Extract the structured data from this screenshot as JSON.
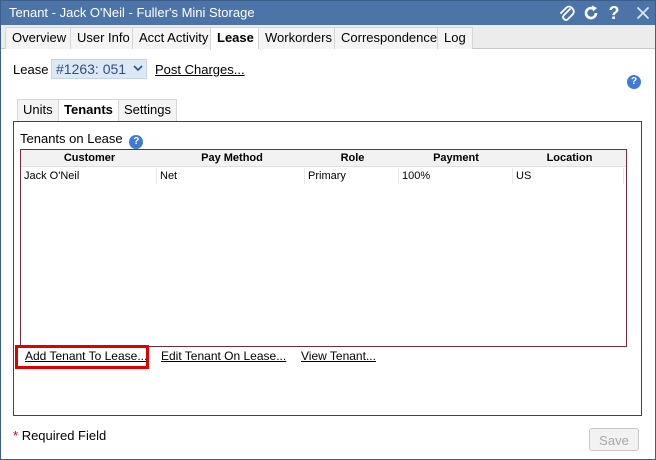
{
  "window": {
    "title": "Tenant - Jack O'Neil - Fuller's Mini Storage"
  },
  "tabs": [
    {
      "label": "Overview",
      "active": false
    },
    {
      "label": "User Info",
      "active": false
    },
    {
      "label": "Acct Activity",
      "active": false
    },
    {
      "label": "Lease",
      "active": true
    },
    {
      "label": "Workorders",
      "active": false
    },
    {
      "label": "Correspondence",
      "active": false
    },
    {
      "label": "Log",
      "active": false
    }
  ],
  "lease": {
    "label": "Lease",
    "selected": "#1263: 051",
    "post_charges": "Post Charges..."
  },
  "subtabs": [
    {
      "label": "Units",
      "active": false
    },
    {
      "label": "Tenants",
      "active": true
    },
    {
      "label": "Settings",
      "active": false
    }
  ],
  "panel": {
    "title": "Tenants on Lease"
  },
  "grid": {
    "columns": [
      "Customer",
      "Pay Method",
      "Role",
      "Payment",
      "Location"
    ],
    "rows": [
      [
        "Jack O'Neil",
        "Net",
        "Primary",
        "100%",
        "US"
      ]
    ]
  },
  "actions": {
    "add_tenant": "Add Tenant To Lease...",
    "edit_tenant": "Edit Tenant On Lease...",
    "view_tenant": "View Tenant..."
  },
  "footer": {
    "required_star": "*",
    "required_text": "Required Field",
    "save": "Save"
  },
  "icons": {
    "attach": "paperclip-icon",
    "refresh": "refresh-icon",
    "help": "help-icon",
    "close": "close-icon"
  },
  "colors": {
    "titlebar": "#4d74a8",
    "panel_border": "#7a2a3c",
    "highlight": "#e00000",
    "help": "#3f7ad6"
  }
}
